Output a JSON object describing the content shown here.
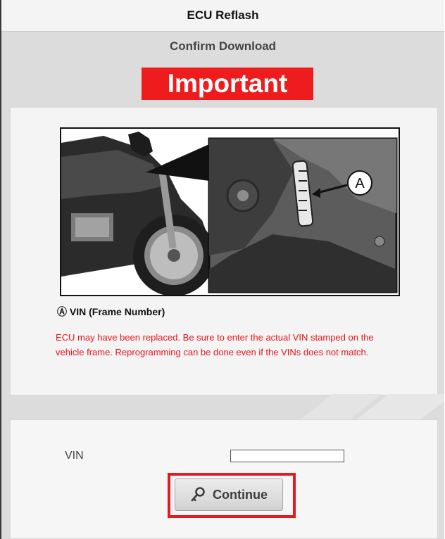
{
  "window": {
    "title": "ECU Reflash"
  },
  "header": {
    "subtitle": "Confirm Download",
    "important_label": "Important"
  },
  "notice": {
    "figure_callout": "A",
    "caption": "Ⓐ VIN (Frame Number)",
    "warning": "ECU may have been replaced. Be sure to enter the actual VIN stamped on the vehicle frame. Reprogramming can be done even if the VINs does not match."
  },
  "form": {
    "vin_label": "VIN",
    "vin_value": "",
    "continue_label": "Continue"
  },
  "colors": {
    "important_bg": "#ee1c1c",
    "warning_text": "#e8141c",
    "highlight": "#e11b22"
  }
}
